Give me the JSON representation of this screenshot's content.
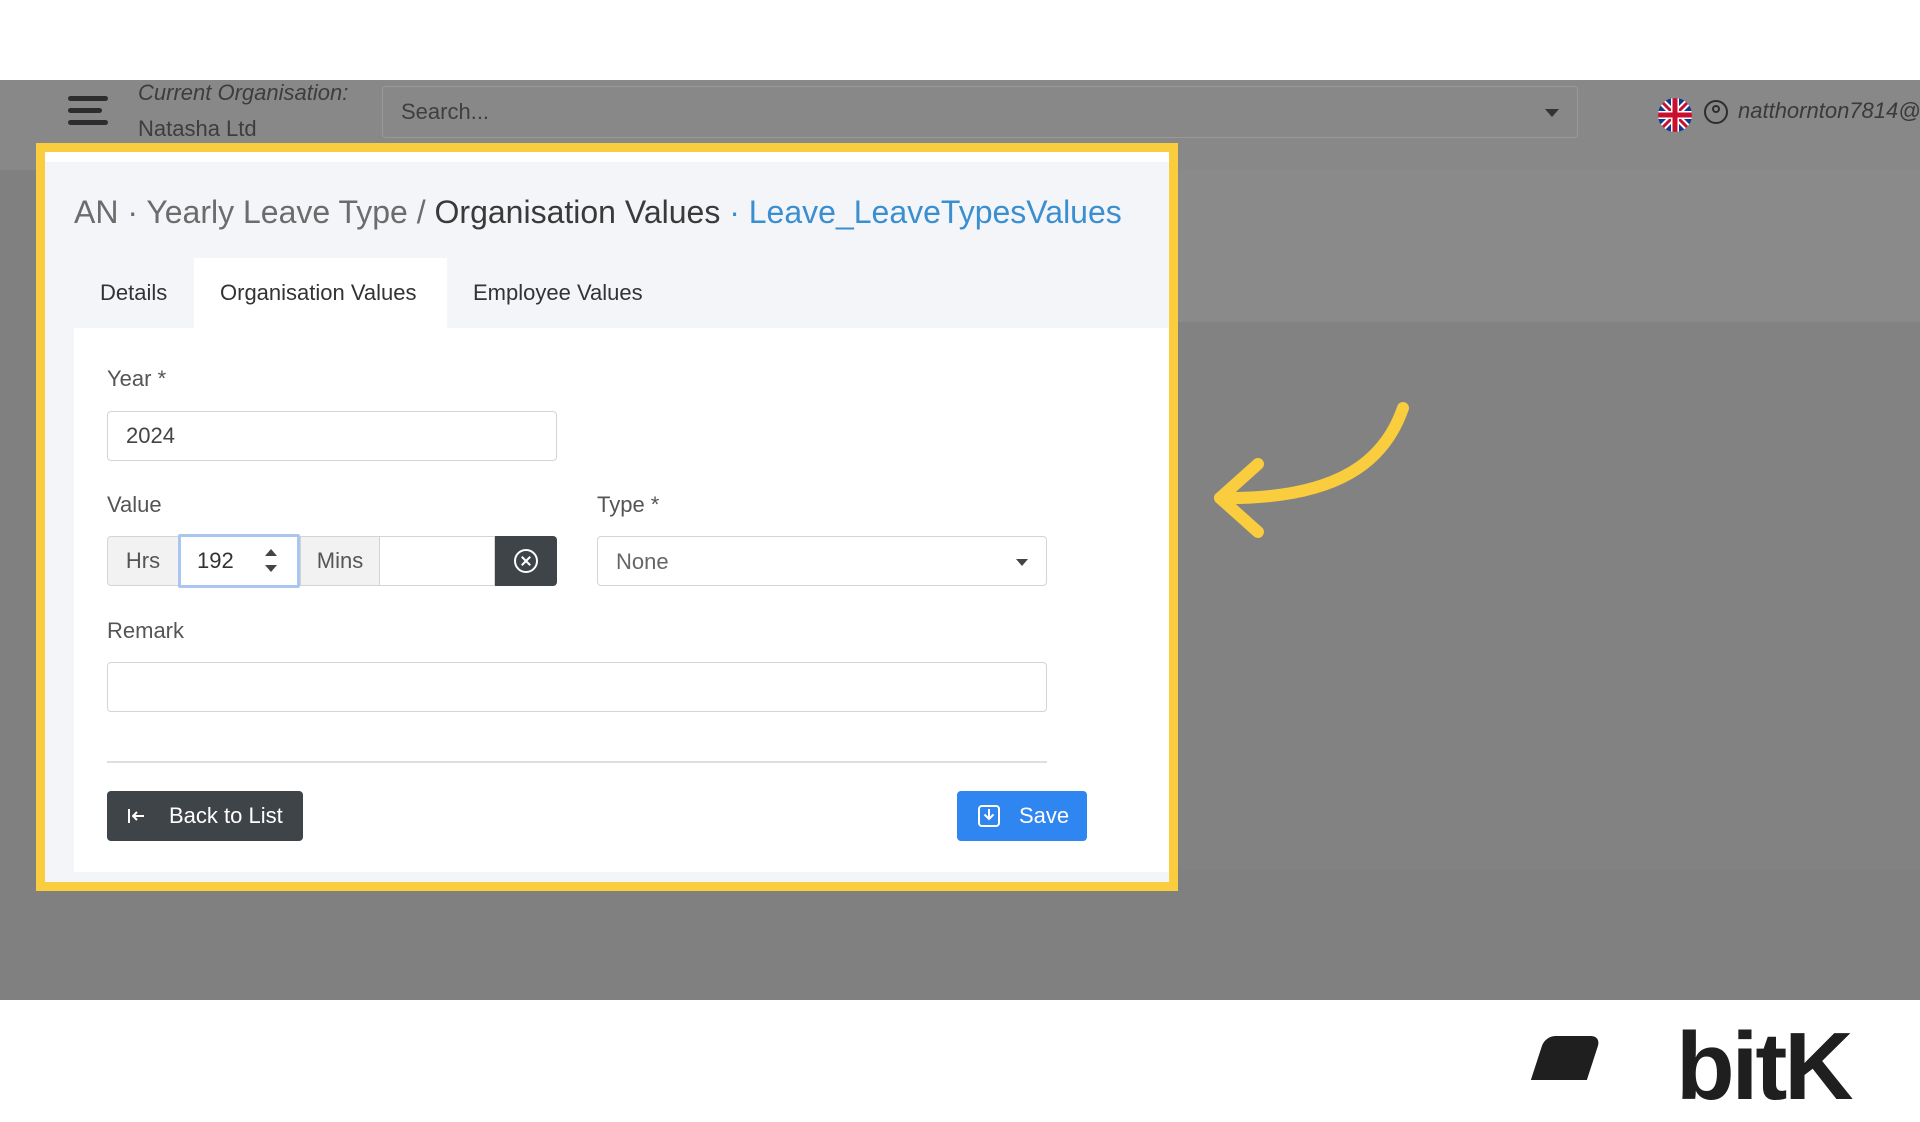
{
  "header": {
    "org_label": "Current Organisation:",
    "org_name": "Natasha Ltd",
    "search_placeholder": "Search...",
    "user_name": "natthornton7814@"
  },
  "breadcrumb": {
    "part1": "AN",
    "sep1": "·",
    "part2": "Yearly Leave Type",
    "sep2": "/",
    "part3": "Organisation Values",
    "sep3": "·",
    "part4": "Leave_LeaveTypesValues"
  },
  "tabs": [
    {
      "label": "Details",
      "active": false
    },
    {
      "label": "Organisation Values",
      "active": true
    },
    {
      "label": "Employee Values",
      "active": false
    }
  ],
  "form": {
    "year_label": "Year *",
    "year_value": "2024",
    "value_label": "Value",
    "hrs_label": "Hrs",
    "hrs_value": "192",
    "mins_label": "Mins",
    "mins_value": "",
    "type_label": "Type *",
    "type_value": "None",
    "remark_label": "Remark",
    "remark_value": ""
  },
  "buttons": {
    "back_label": "Back to List",
    "save_label": "Save"
  },
  "brand": {
    "text": "bitK"
  },
  "colors": {
    "highlight": "#f9cd3e",
    "link": "#3a8fd0",
    "save": "#2f86f0",
    "dark_button": "#3f4449"
  }
}
